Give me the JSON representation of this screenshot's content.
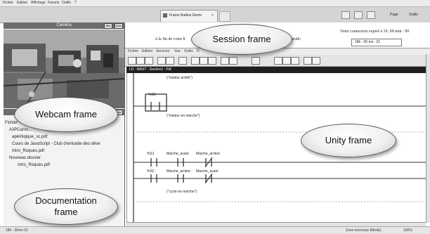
{
  "browser": {
    "menu": [
      "Fichier",
      "Edition",
      "Affichage",
      "Favoris",
      "Outils",
      "?"
    ],
    "tab_title": "Frame Radios Demo",
    "tab_close": "×",
    "right_toolbar": [
      "Page",
      "Outils"
    ]
  },
  "webcam": {
    "title": "Caméra",
    "btn_min": "Min",
    "btn_max": "Max"
  },
  "documents": {
    "items": [
      "Fichier",
      "A3PCamo...",
      "apéritiqique_sc.pdf",
      "Cours de JavaScript - Club d'entraide des déve",
      "Intro_Roques.pdf",
      "Nouveau dossier",
      "Intro_Roques.pdf"
    ]
  },
  "session": {
    "left_text": "A la fin de votre li",
    "right_suffix": "pruib:",
    "expiry_text": "Votre connexion expiré à 1h :00 min : 00",
    "time_value": "18h : 00 mn : 01"
  },
  "unity": {
    "menu": [
      "Fichier",
      "Edition",
      "Services",
      "Vue",
      "Outils",
      "D"
    ],
    "section_title": "LD : MAST - Section1 : Pdl",
    "comments": [
      "(\"moteur arrêté\")",
      "(\"moteur en marche\")",
      "(\"cycle en marche\")"
    ],
    "contact_labels": [
      "%S0",
      "%S1",
      "%S2"
    ],
    "contacts_row3": [
      "Marche_avant",
      "Marche_arrière"
    ],
    "contacts_row4": [
      "Marche_arrière",
      "Marche_avant"
    ]
  },
  "status": {
    "left": "18h : 30mn 01",
    "zone": "Zone inconnue (Mode)",
    "zoom": "100%"
  },
  "overlays": {
    "session": "Session frame",
    "webcam": "Webcam frame",
    "unity": "Unity frame",
    "documentation_line1": "Documentation",
    "documentation_line2": "frame"
  }
}
